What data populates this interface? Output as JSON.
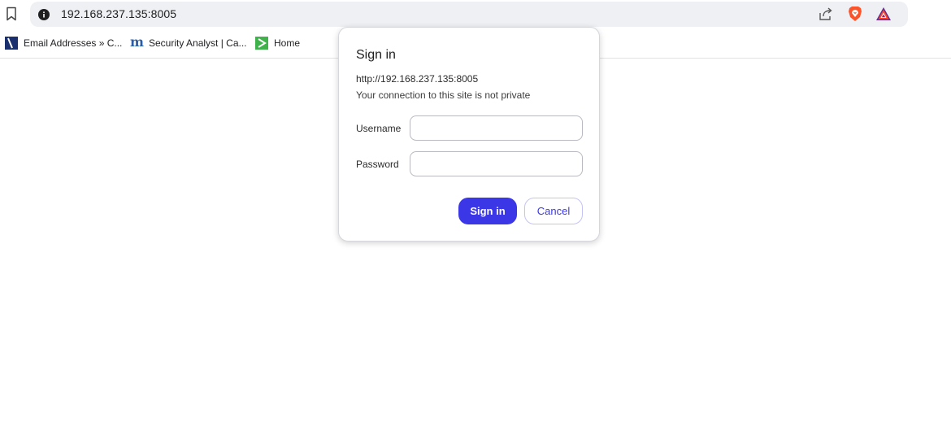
{
  "browser": {
    "url": "192.168.237.135:8005",
    "accent_color": "#3b37e6",
    "bookmarks": [
      {
        "label": "Email Addresses » C...",
        "icon": "v-logo-icon"
      },
      {
        "label": "Security Analyst | Ca...",
        "icon": "m-logo-icon"
      },
      {
        "label": "Home",
        "icon": "home-chevron-icon"
      }
    ]
  },
  "dialog": {
    "title": "Sign in",
    "origin": "http://192.168.237.135:8005",
    "warning": "Your connection to this site is not private",
    "username_label": "Username",
    "username_value": "",
    "password_label": "Password",
    "password_value": "",
    "sign_in_label": "Sign in",
    "cancel_label": "Cancel"
  }
}
